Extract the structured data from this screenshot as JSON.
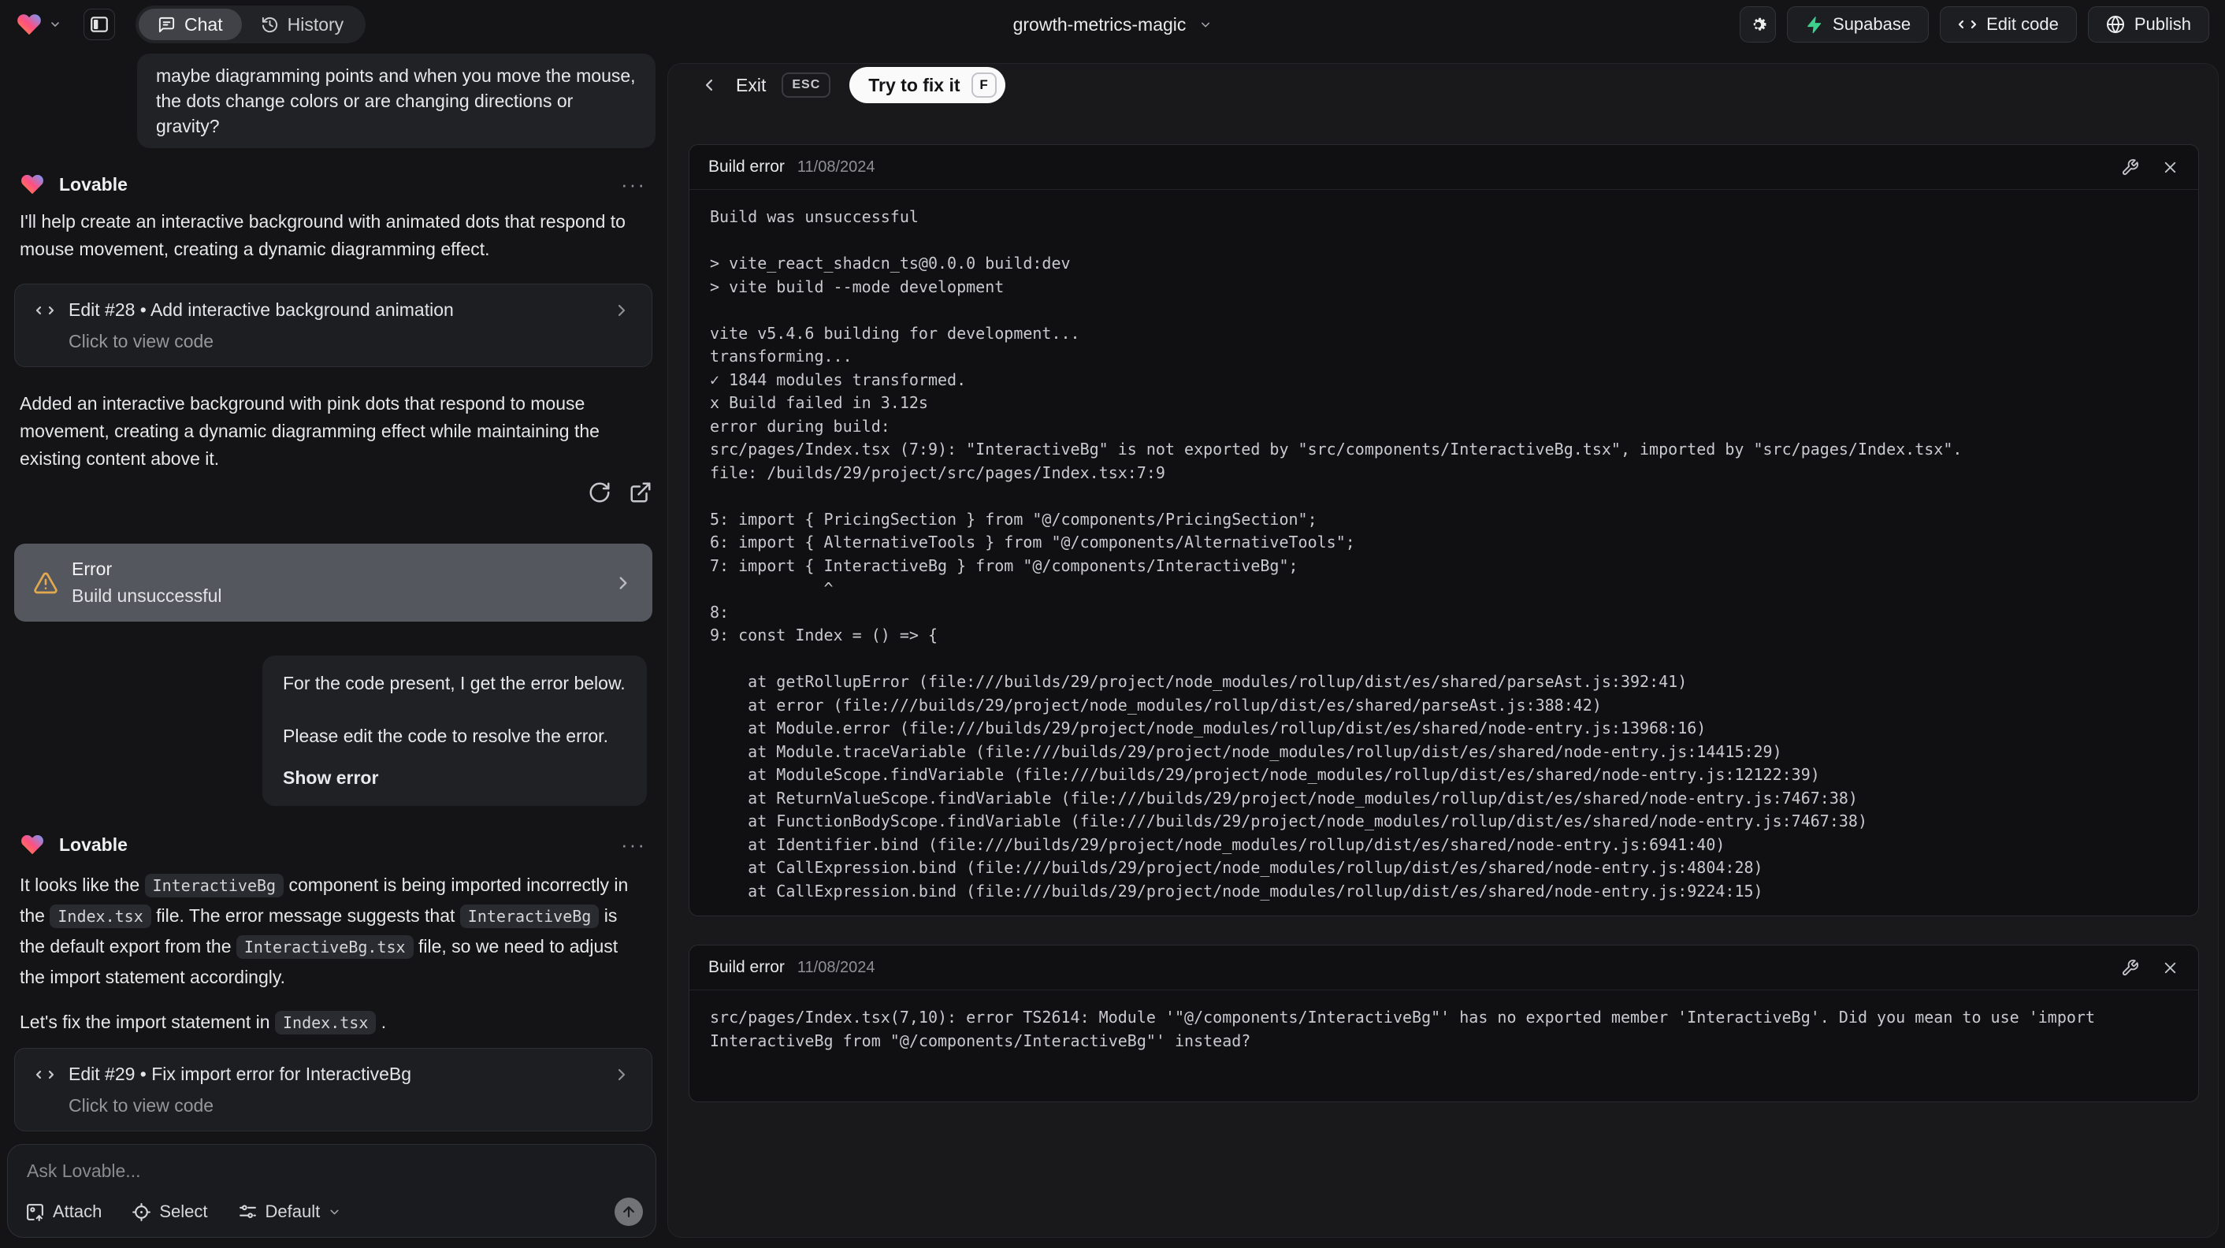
{
  "topbar": {
    "tabs": {
      "chat": "Chat",
      "history": "History"
    },
    "project_name": "growth-metrics-magic",
    "buttons": {
      "supabase": "Supabase",
      "edit_code": "Edit code",
      "publish": "Publish"
    }
  },
  "chat": {
    "assistant_name": "Lovable",
    "menu_dots": "···",
    "user_message_1": "maybe diagramming points and when you move the mouse, the dots change colors or are changing directions or gravity?",
    "message_1": {
      "intro": "I'll help create an interactive background with animated dots that respond to mouse movement, creating a dynamic diagramming effect.",
      "edit_card": {
        "title": "Edit #28 • Add interactive background animation",
        "subtitle": "Click to view code"
      },
      "summary": "Added an interactive background with pink dots that respond to mouse movement, creating a dynamic diagramming effect while maintaining the existing content above it.",
      "error_card": {
        "title": "Error",
        "subtitle": "Build unsuccessful"
      }
    },
    "user_message_2": {
      "line1": "For the code present, I get the error below.",
      "line2": "Please edit the code to resolve the error.",
      "action": "Show error"
    },
    "message_2": {
      "parts": [
        {
          "t": "text",
          "v": "It looks like the "
        },
        {
          "t": "code",
          "v": "InteractiveBg"
        },
        {
          "t": "text",
          "v": " component is being imported incorrectly in the "
        },
        {
          "t": "code",
          "v": "Index.tsx"
        },
        {
          "t": "text",
          "v": " file. The error message suggests that "
        },
        {
          "t": "code",
          "v": "InteractiveBg"
        },
        {
          "t": "text",
          "v": " is the default export from the "
        },
        {
          "t": "code",
          "v": "InteractiveBg.tsx"
        },
        {
          "t": "text",
          "v": " file, so we need to adjust the import statement accordingly."
        }
      ],
      "line2_parts": [
        {
          "t": "text",
          "v": "Let's fix the import statement in "
        },
        {
          "t": "code",
          "v": "Index.tsx"
        },
        {
          "t": "text",
          "v": " ."
        }
      ],
      "edit_card": {
        "title": "Edit #29 • Fix import error for InteractiveBg",
        "subtitle": "Click to view code"
      }
    },
    "input": {
      "placeholder": "Ask Lovable...",
      "attach": "Attach",
      "select": "Select",
      "mode": "Default"
    }
  },
  "fix_panel": {
    "exit": "Exit",
    "esc_key": "ESC",
    "fix_button": "Try to fix it",
    "fix_key": "F",
    "error_cards": [
      {
        "title": "Build error",
        "date": "11/08/2024",
        "log": "Build was unsuccessful\n\n> vite_react_shadcn_ts@0.0.0 build:dev\n> vite build --mode development\n\nvite v5.4.6 building for development...\ntransforming...\n✓ 1844 modules transformed.\nx Build failed in 3.12s\nerror during build:\nsrc/pages/Index.tsx (7:9): \"InteractiveBg\" is not exported by \"src/components/InteractiveBg.tsx\", imported by \"src/pages/Index.tsx\".\nfile: /builds/29/project/src/pages/Index.tsx:7:9\n\n5: import { PricingSection } from \"@/components/PricingSection\";\n6: import { AlternativeTools } from \"@/components/AlternativeTools\";\n7: import { InteractiveBg } from \"@/components/InteractiveBg\";\n            ^\n8: \n9: const Index = () => {\n\n    at getRollupError (file:///builds/29/project/node_modules/rollup/dist/es/shared/parseAst.js:392:41)\n    at error (file:///builds/29/project/node_modules/rollup/dist/es/shared/parseAst.js:388:42)\n    at Module.error (file:///builds/29/project/node_modules/rollup/dist/es/shared/node-entry.js:13968:16)\n    at Module.traceVariable (file:///builds/29/project/node_modules/rollup/dist/es/shared/node-entry.js:14415:29)\n    at ModuleScope.findVariable (file:///builds/29/project/node_modules/rollup/dist/es/shared/node-entry.js:12122:39)\n    at ReturnValueScope.findVariable (file:///builds/29/project/node_modules/rollup/dist/es/shared/node-entry.js:7467:38)\n    at FunctionBodyScope.findVariable (file:///builds/29/project/node_modules/rollup/dist/es/shared/node-entry.js:7467:38)\n    at Identifier.bind (file:///builds/29/project/node_modules/rollup/dist/es/shared/node-entry.js:6941:40)\n    at CallExpression.bind (file:///builds/29/project/node_modules/rollup/dist/es/shared/node-entry.js:4804:28)\n    at CallExpression.bind (file:///builds/29/project/node_modules/rollup/dist/es/shared/node-entry.js:9224:15)"
      },
      {
        "title": "Build error",
        "date": "11/08/2024",
        "log": "src/pages/Index.tsx(7,10): error TS2614: Module '\"@/components/InteractiveBg\"' has no exported member 'InteractiveBg'. Did you mean to use 'import InteractiveBg from \"@/components/InteractiveBg\"' instead?"
      }
    ]
  },
  "colors": {
    "supabase_green": "#3ecf8e",
    "warning_amber": "#e2a94e",
    "fix_pill_bg": "#fafafa"
  }
}
